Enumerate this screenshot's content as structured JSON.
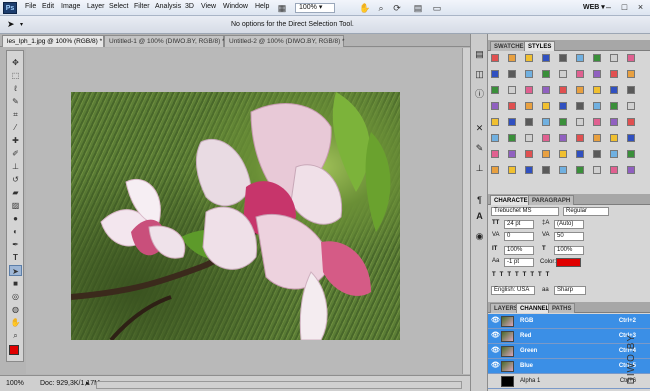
{
  "app": {
    "logo": "Ps"
  },
  "menubar": {
    "items": [
      "File",
      "Edit",
      "Image",
      "Layer",
      "Select",
      "Filter",
      "Analysis",
      "3D",
      "View",
      "Window",
      "Help"
    ],
    "zoom": "100%",
    "workspace": "WEB",
    "window_buttons": [
      "–",
      "□",
      "×"
    ]
  },
  "optionsbar": {
    "message": "No options for the Direct Selection Tool."
  },
  "tabs": [
    {
      "label": "les_lph_1.jpg @ 100% (RGB/8) *",
      "active": true
    },
    {
      "label": "Untitled-1 @ 100% (DIWO.BY, RGB/8) *",
      "active": false
    },
    {
      "label": "Untitled-2 @ 100% (DIWO.BY, RGB/8) *",
      "active": false
    }
  ],
  "status": {
    "zoom": "100%",
    "doc": "Doc: 929,3K/1,17M"
  },
  "colors": {
    "foreground": "#e00000",
    "background": "#ffffff",
    "selection": "#3b8fe6"
  },
  "swatches_panel": {
    "tabs": [
      "SWATCHES",
      "STYLES"
    ],
    "active_tab": "STYLES"
  },
  "character_panel": {
    "tabs": [
      "CHARACTER",
      "PARAGRAPH"
    ],
    "font_family": "Trebuchet MS",
    "font_style": "Regular",
    "font_size": "24 pt",
    "leading": "(Auto)",
    "kerning": "0",
    "tracking": "50",
    "vertical_scale": "100%",
    "horizontal_scale": "100%",
    "baseline_shift": "-1 pt",
    "color_label": "Color:",
    "color": "#e00000",
    "language": "English: USA",
    "antialias_icon": "aa",
    "antialias": "Sharp"
  },
  "layers_panel": {
    "tabs": [
      "LAYERS",
      "CHANNELS",
      "PATHS"
    ],
    "active_tab": "CHANNELS",
    "channels": [
      {
        "name": "RGB",
        "shortcut": "Ctrl+2",
        "selected": true
      },
      {
        "name": "Red",
        "shortcut": "Ctrl+3",
        "selected": true
      },
      {
        "name": "Green",
        "shortcut": "Ctrl+4",
        "selected": true
      },
      {
        "name": "Blue",
        "shortcut": "Ctrl+5",
        "selected": true
      },
      {
        "name": "Alpha 1",
        "shortcut": "Ctrl+6",
        "selected": false
      }
    ]
  },
  "watermark": "DIWO.BY"
}
